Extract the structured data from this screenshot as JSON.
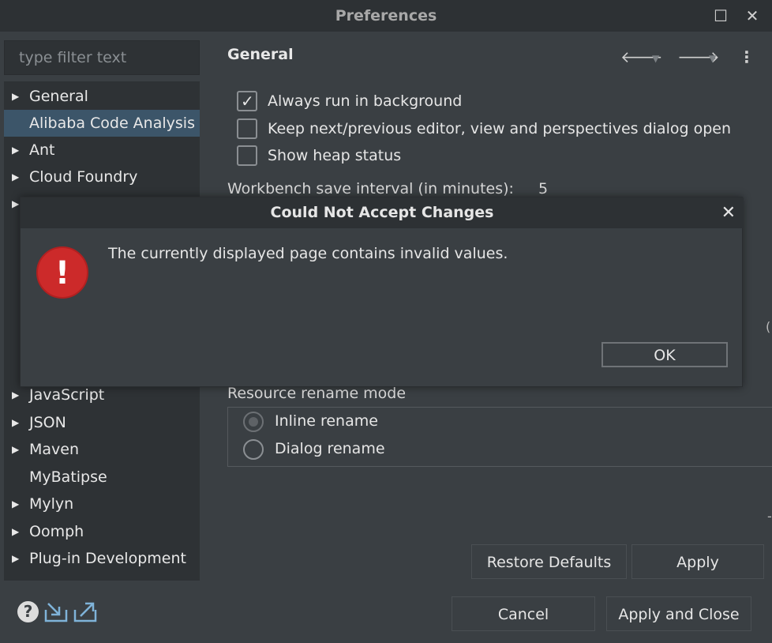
{
  "window": {
    "title": "Preferences",
    "maximize_icon": "maximize-icon",
    "close_icon": "close-icon"
  },
  "sidebar": {
    "filter_placeholder": "type filter text",
    "items": [
      {
        "label": "General",
        "expandable": true,
        "selected": false
      },
      {
        "label": "Alibaba Code Analysis",
        "expandable": false,
        "selected": true
      },
      {
        "label": "Ant",
        "expandable": true,
        "selected": false
      },
      {
        "label": "Cloud Foundry",
        "expandable": true,
        "selected": false
      },
      {
        "label": "JavaScript",
        "expandable": true,
        "selected": false
      },
      {
        "label": "JSON",
        "expandable": true,
        "selected": false
      },
      {
        "label": "Maven",
        "expandable": true,
        "selected": false
      },
      {
        "label": "MyBatipse",
        "expandable": false,
        "selected": false
      },
      {
        "label": "Mylyn",
        "expandable": true,
        "selected": false
      },
      {
        "label": "Oomph",
        "expandable": true,
        "selected": false
      },
      {
        "label": "Plug-in Development",
        "expandable": true,
        "selected": false
      }
    ]
  },
  "main": {
    "title": "General",
    "checkboxes": [
      {
        "label": "Always run in background",
        "checked": true
      },
      {
        "label": "Keep next/previous editor, view and perspectives dialog open",
        "checked": false
      },
      {
        "label": "Show heap status",
        "checked": false
      }
    ],
    "workbench_interval_label": "Workbench save interval (in minutes):",
    "workbench_interval_value": "5",
    "rename_group_label": "Resource rename mode",
    "rename_options": [
      {
        "label": "Inline rename",
        "selected": true
      },
      {
        "label": "Dialog rename",
        "selected": false
      }
    ],
    "restore_defaults_label": "Restore Defaults",
    "apply_label": "Apply"
  },
  "footer": {
    "cancel_label": "Cancel",
    "apply_close_label": "Apply and Close"
  },
  "dialog": {
    "title": "Could Not Accept Changes",
    "message": "The currently displayed page contains invalid values.",
    "ok_label": "OK",
    "icon": "error-icon"
  },
  "colors": {
    "background": "#3a3f43",
    "titlebar": "#2d3134",
    "selection": "#3c5569",
    "error": "#cc2a2a"
  }
}
